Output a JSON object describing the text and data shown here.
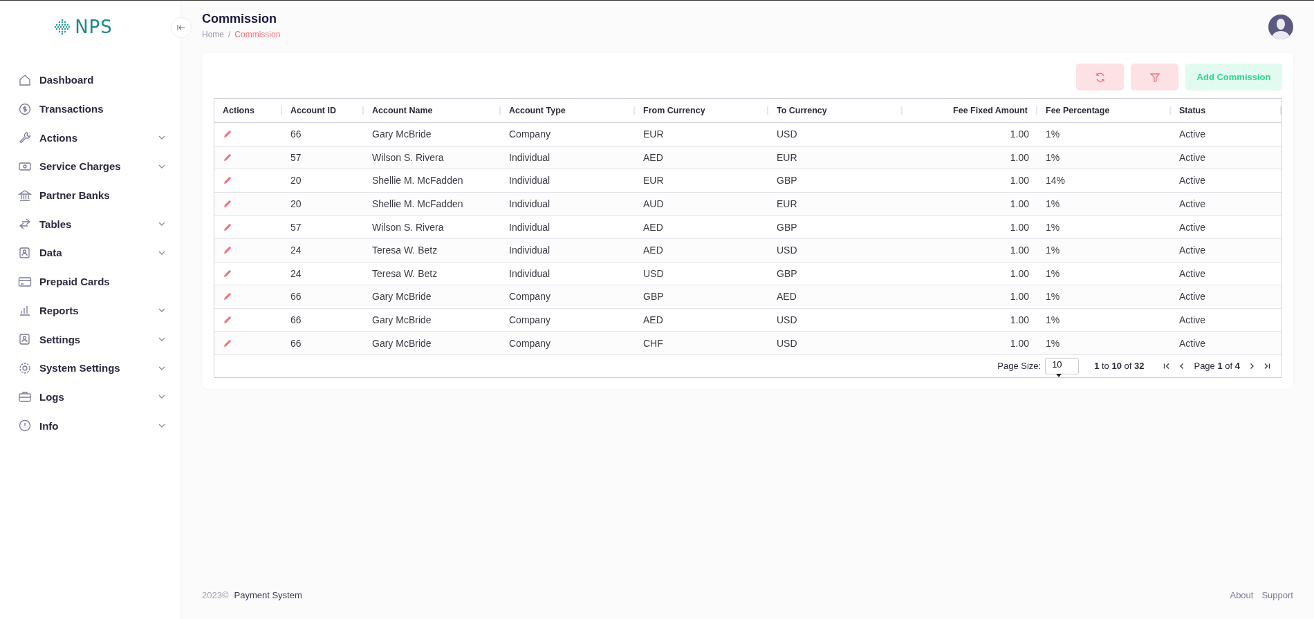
{
  "sidebar": {
    "logo": "NPS",
    "items": [
      {
        "label": "Dashboard",
        "has_submenu": false
      },
      {
        "label": "Transactions",
        "has_submenu": false
      },
      {
        "label": "Actions",
        "has_submenu": true
      },
      {
        "label": "Service Charges",
        "has_submenu": true
      },
      {
        "label": "Partner Banks",
        "has_submenu": false
      },
      {
        "label": "Tables",
        "has_submenu": true
      },
      {
        "label": "Data",
        "has_submenu": true
      },
      {
        "label": "Prepaid Cards",
        "has_submenu": false
      },
      {
        "label": "Reports",
        "has_submenu": true
      },
      {
        "label": "Settings",
        "has_submenu": true
      },
      {
        "label": "System Settings",
        "has_submenu": true
      },
      {
        "label": "Logs",
        "has_submenu": true
      },
      {
        "label": "Info",
        "has_submenu": true
      }
    ]
  },
  "header": {
    "title": "Commission",
    "breadcrumb": [
      "Home",
      "Commission"
    ],
    "breadcrumb_separator": "/"
  },
  "toolbar": {
    "add_button": "Add Commission"
  },
  "table": {
    "columns": [
      "Actions",
      "Account ID",
      "Account Name",
      "Account Type",
      "From Currency",
      "To Currency",
      "Fee Fixed Amount",
      "Fee Percentage",
      "Status"
    ],
    "rows": [
      [
        "",
        "66",
        "Gary McBride",
        "Company",
        "EUR",
        "USD",
        "1.00",
        "1%",
        "Active"
      ],
      [
        "",
        "57",
        "Wilson S. Rivera",
        "Individual",
        "AED",
        "EUR",
        "1.00",
        "1%",
        "Active"
      ],
      [
        "",
        "20",
        "Shellie M. McFadden",
        "Individual",
        "EUR",
        "GBP",
        "1.00",
        "14%",
        "Active"
      ],
      [
        "",
        "20",
        "Shellie M. McFadden",
        "Individual",
        "AUD",
        "EUR",
        "1.00",
        "1%",
        "Active"
      ],
      [
        "",
        "57",
        "Wilson S. Rivera",
        "Individual",
        "AED",
        "GBP",
        "1.00",
        "1%",
        "Active"
      ],
      [
        "",
        "24",
        "Teresa W. Betz",
        "Individual",
        "AED",
        "USD",
        "1.00",
        "1%",
        "Active"
      ],
      [
        "",
        "24",
        "Teresa W. Betz",
        "Individual",
        "USD",
        "GBP",
        "1.00",
        "1%",
        "Active"
      ],
      [
        "",
        "66",
        "Gary McBride",
        "Company",
        "GBP",
        "AED",
        "1.00",
        "1%",
        "Active"
      ],
      [
        "",
        "66",
        "Gary McBride",
        "Company",
        "AED",
        "USD",
        "1.00",
        "1%",
        "Active"
      ],
      [
        "",
        "66",
        "Gary McBride",
        "Company",
        "CHF",
        "USD",
        "1.00",
        "1%",
        "Active"
      ]
    ]
  },
  "pagination": {
    "page_size_label": "Page Size:",
    "page_size": "10",
    "range": "**1** to **10** of **32**",
    "page": "Page **1** of **4**"
  },
  "footer": {
    "year": "2023©",
    "company": "Payment System",
    "links": [
      "About",
      "Support"
    ]
  }
}
